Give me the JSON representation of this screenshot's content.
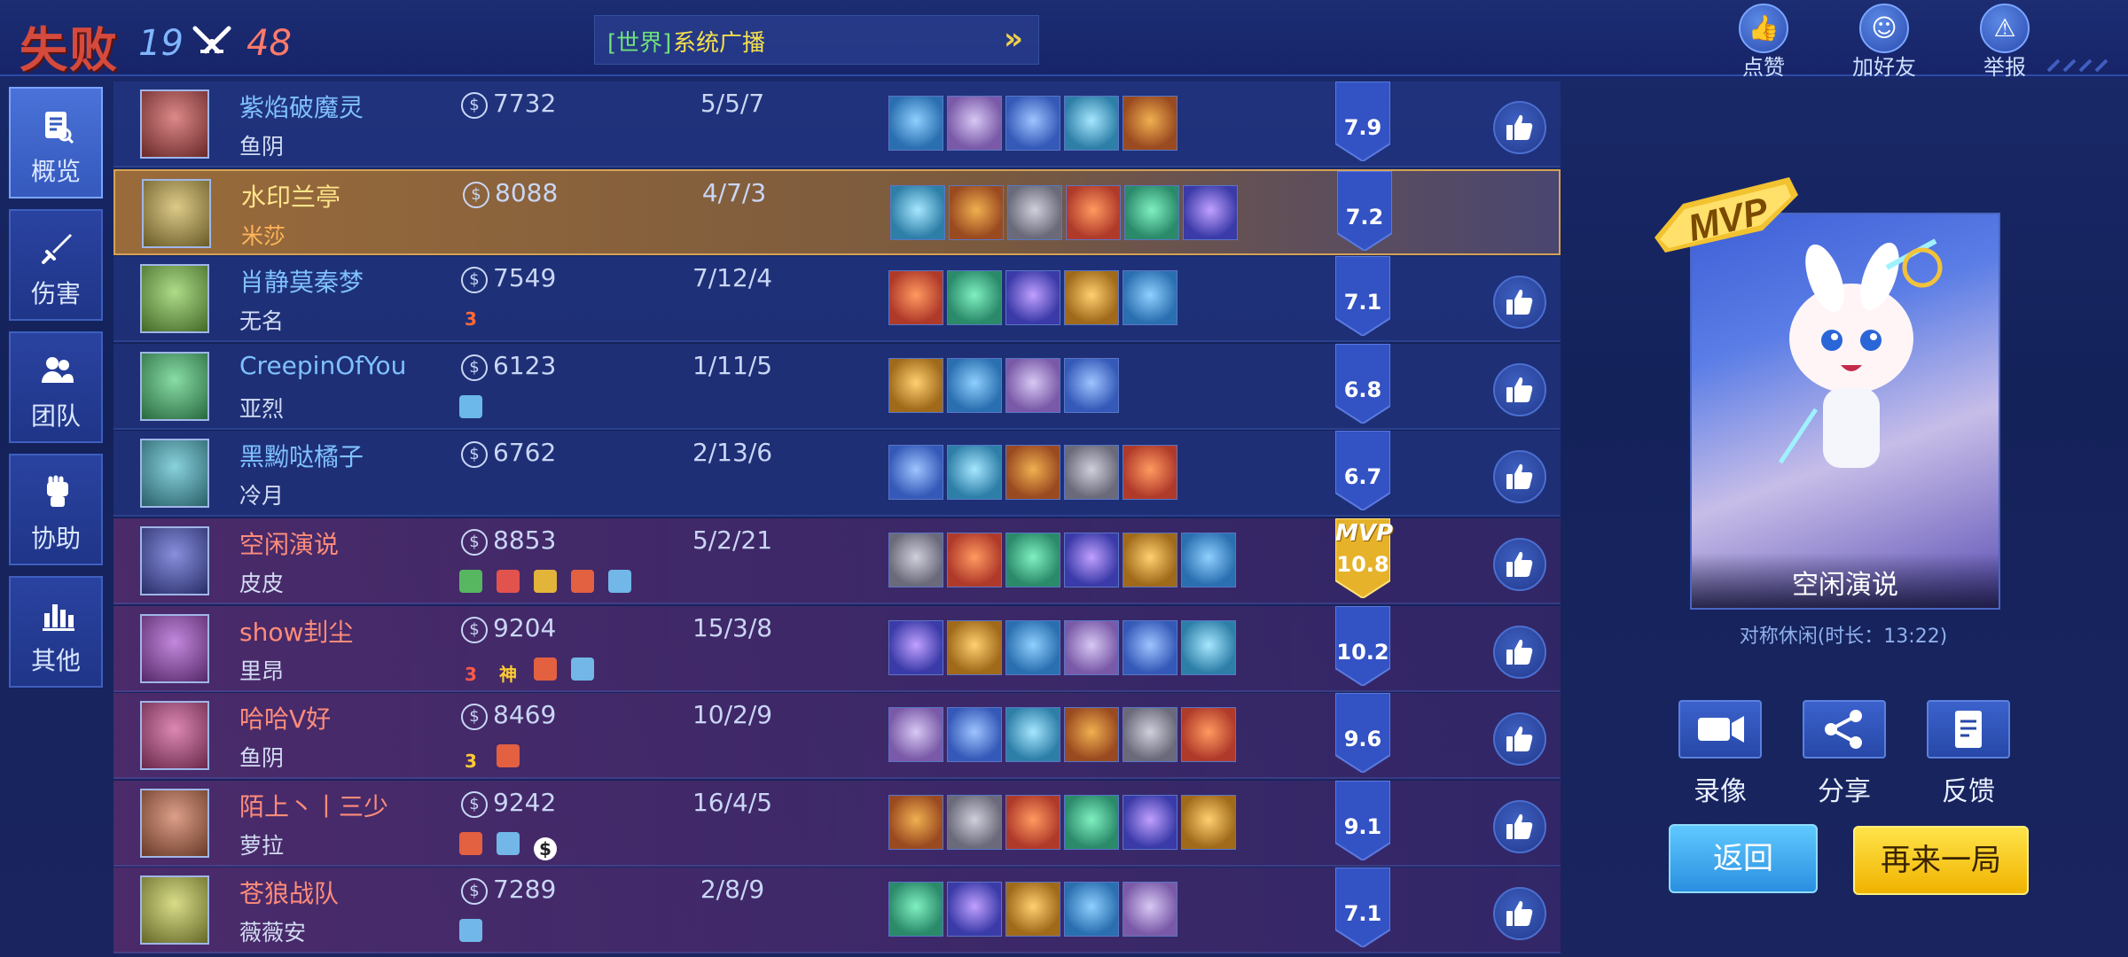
{
  "header": {
    "result": "失败",
    "score_blue": "19",
    "score_red": "48",
    "broadcast_tag": "[世界]",
    "broadcast_text": "系统广播",
    "buttons": [
      {
        "label": "点赞",
        "icon": "thumbs-up-icon"
      },
      {
        "label": "加好友",
        "icon": "add-friend-icon"
      },
      {
        "label": "举报",
        "icon": "warning-icon"
      }
    ]
  },
  "sidebar": {
    "items": [
      {
        "label": "概览",
        "icon": "overview-icon",
        "active": true
      },
      {
        "label": "伤害",
        "icon": "sword-icon"
      },
      {
        "label": "团队",
        "icon": "team-icon"
      },
      {
        "label": "协助",
        "icon": "fist-icon"
      },
      {
        "label": "其他",
        "icon": "bar-chart-icon"
      }
    ]
  },
  "players": [
    {
      "team": "blue",
      "name": "紫焰破魔灵",
      "hero": "鱼阴",
      "gold": "7732",
      "kda": "5/5/7",
      "rating": "7.9",
      "items": 5,
      "badges": []
    },
    {
      "team": "me",
      "name": "水印兰亭",
      "hero": "米莎",
      "gold": "8088",
      "kda": "4/7/3",
      "rating": "7.2",
      "items": 6,
      "badges": []
    },
    {
      "team": "blue",
      "name": "肖静莫秦梦",
      "hero": "无名",
      "gold": "7549",
      "kda": "7/12/4",
      "rating": "7.1",
      "items": 5,
      "badges": [
        "3"
      ]
    },
    {
      "team": "blue",
      "name": "CreepinOfYou",
      "hero": "亚烈",
      "gold": "6123",
      "kda": "1/11/5",
      "rating": "6.8",
      "items": 4,
      "badges": [
        ""
      ]
    },
    {
      "team": "blue",
      "name": "黑黝哒橘子",
      "hero": "冷月",
      "gold": "6762",
      "kda": "2/13/6",
      "rating": "6.7",
      "items": 5,
      "badges": []
    },
    {
      "team": "red",
      "name": "空闲演说",
      "hero": "皮皮",
      "gold": "8853",
      "kda": "5/2/21",
      "rating": "10.8",
      "mvp": "MVP",
      "items": 6,
      "badges": [
        "",
        "",
        "",
        "",
        ""
      ]
    },
    {
      "team": "red",
      "name": "show刲尘",
      "hero": "里昂",
      "gold": "9204",
      "kda": "15/3/8",
      "rating": "10.2",
      "items": 6,
      "badges": [
        "3",
        "神",
        "",
        ""
      ]
    },
    {
      "team": "red",
      "name": "哈哈V好",
      "hero": "鱼阴",
      "gold": "8469",
      "kda": "10/2/9",
      "rating": "9.6",
      "items": 6,
      "badges": [
        "3",
        ""
      ]
    },
    {
      "team": "red",
      "name": "陌上丶丨三少",
      "hero": "萝拉",
      "gold": "9242",
      "kda": "16/4/5",
      "rating": "9.1",
      "items": 6,
      "badges": [
        "",
        "",
        "$"
      ]
    },
    {
      "team": "red",
      "name": "苍狼战队",
      "hero": "薇薇安",
      "gold": "7289",
      "kda": "2/8/9",
      "rating": "7.1",
      "items": 5,
      "badges": [
        ""
      ]
    }
  ],
  "mvp_panel": {
    "logo": "MVP",
    "player": "空闲演说",
    "mode": "对称休闲(时长：13:22)"
  },
  "actions": [
    {
      "label": "录像",
      "icon": "camera-icon"
    },
    {
      "label": "分享",
      "icon": "share-icon"
    },
    {
      "label": "反馈",
      "icon": "feedback-icon"
    }
  ],
  "buttons": {
    "back": "返回",
    "again": "再来一局"
  },
  "colors": {
    "blue_row": "#263a8c",
    "red_row": "#5c2d6e",
    "me_row": "#9a6b3a",
    "accent_gold": "#f0b300",
    "accent_blue": "#2a8fe0"
  }
}
